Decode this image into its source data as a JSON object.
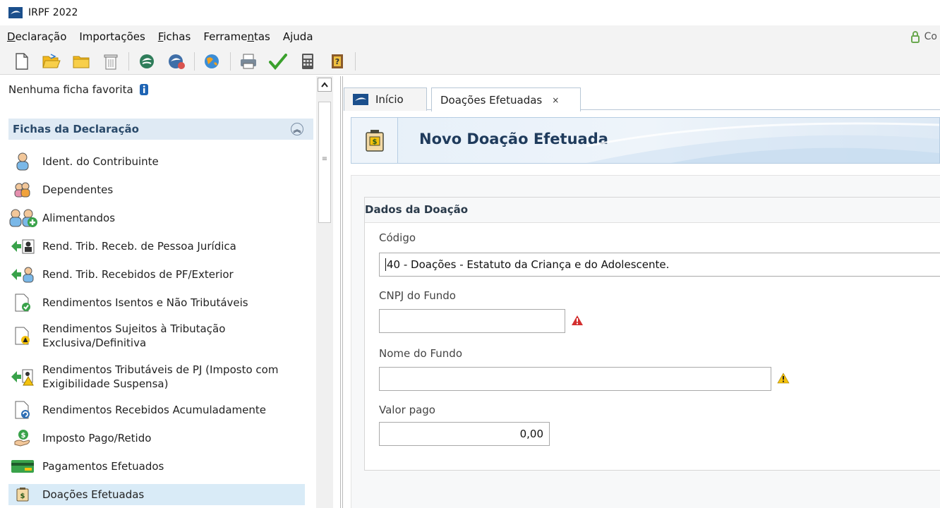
{
  "window": {
    "title": "IRPF 2022"
  },
  "menu": {
    "items": [
      {
        "label": "Declaração",
        "underline": "D"
      },
      {
        "label": "Importações",
        "underline": ""
      },
      {
        "label": "Fichas",
        "underline": "F"
      },
      {
        "label": "Ferramentas",
        "underline": "n"
      },
      {
        "label": "Ajuda",
        "underline": "j"
      }
    ],
    "secure_label": "Co"
  },
  "toolbar": {
    "icons": [
      "new-file-icon",
      "open-folder-icon",
      "folder-icon",
      "trash-icon",
      "transmit-icon",
      "receipt-icon",
      "globe-icon",
      "print-icon",
      "check-icon",
      "calculator-icon",
      "help-book-icon"
    ]
  },
  "sidebar": {
    "favorites_label": "Nenhuma ficha favorita",
    "section_title": "Fichas da Declaração",
    "items": [
      {
        "label": "Ident. do Contribuinte"
      },
      {
        "label": "Dependentes"
      },
      {
        "label": "Alimentandos"
      },
      {
        "label": "Rend. Trib. Receb. de Pessoa Jurídica"
      },
      {
        "label": "Rend. Trib. Recebidos de PF/Exterior"
      },
      {
        "label": "Rendimentos Isentos e Não Tributáveis"
      },
      {
        "label": "Rendimentos Sujeitos à Tributação Exclusiva/Definitiva"
      },
      {
        "label": "Rendimentos Tributáveis de PJ (Imposto com Exigibilidade Suspensa)"
      },
      {
        "label": "Rendimentos Recebidos Acumuladamente"
      },
      {
        "label": "Imposto Pago/Retido"
      },
      {
        "label": "Pagamentos Efetuados"
      },
      {
        "label": "Doações Efetuadas"
      }
    ]
  },
  "tabs": {
    "inicio": "Início",
    "doacoes": "Doações Efetuadas",
    "close": "×"
  },
  "banner": {
    "title": "Novo Doação Efetuada"
  },
  "form": {
    "section_title": "Dados da Doação",
    "codigo_label": "Código",
    "codigo_value": "40 - Doações - Estatuto da Criança e do Adolescente.",
    "cnpj_label": "CNPJ do Fundo",
    "cnpj_value": "",
    "nome_label": "Nome do Fundo",
    "nome_value": "",
    "valor_label": "Valor pago",
    "valor_value": "0,00"
  },
  "colors": {
    "accent": "#1f3b5c",
    "section_bg": "#dfeaf4",
    "selected_bg": "#d9ebf7",
    "error": "#d32f2f",
    "warning": "#f4c20d"
  }
}
